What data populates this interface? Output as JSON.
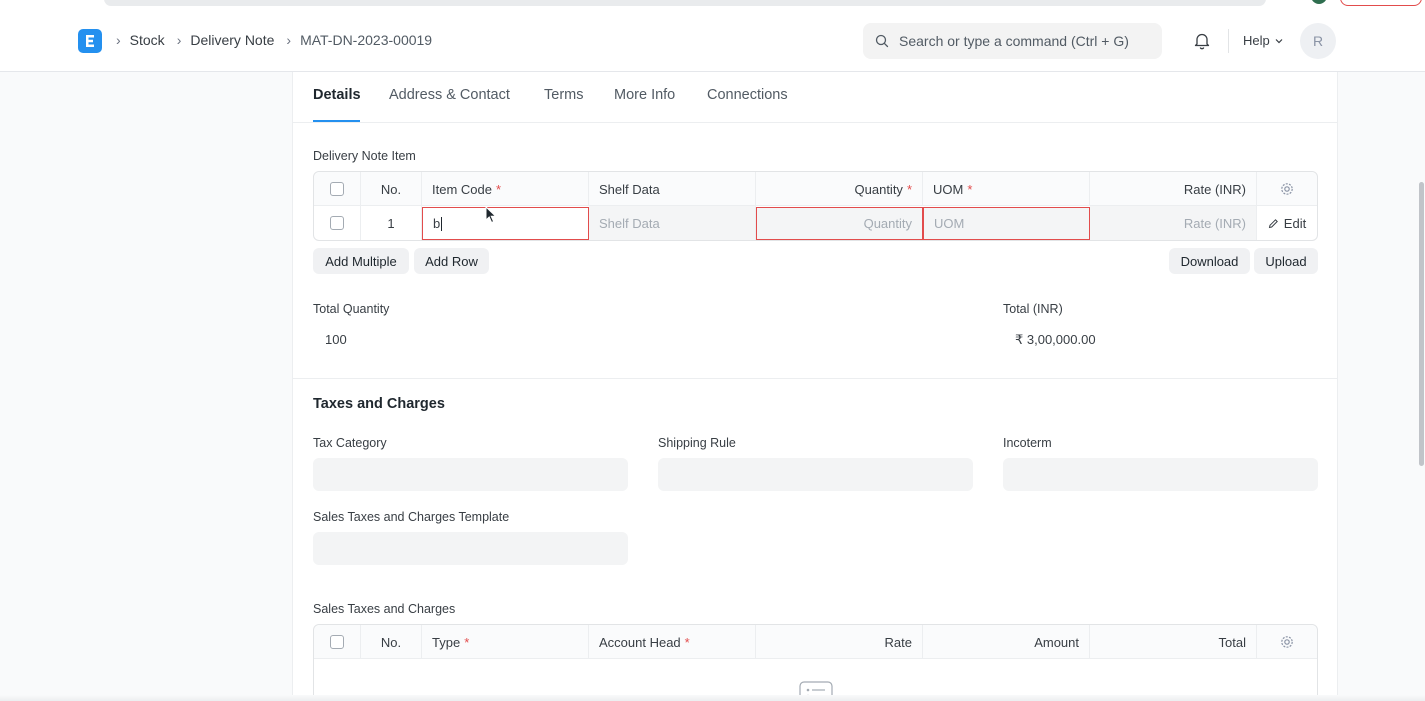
{
  "navbar": {
    "breadcrumbs": [
      "Stock",
      "Delivery Note",
      "MAT-DN-2023-00019"
    ],
    "search_placeholder": "Search or type a command (Ctrl + G)",
    "help_label": "Help",
    "avatar_initial": "R",
    "logo_letter": "E"
  },
  "tabs": [
    "Details",
    "Address & Contact",
    "Terms",
    "More Info",
    "Connections"
  ],
  "active_tab": "Details",
  "items_table": {
    "label": "Delivery Note Item",
    "columns": {
      "no": "No.",
      "item_code": "Item Code",
      "shelf_data": "Shelf Data",
      "quantity": "Quantity",
      "uom": "UOM",
      "rate": "Rate (INR)"
    },
    "row": {
      "no": "1",
      "item_code_value": "b",
      "shelf_placeholder": "Shelf Data",
      "quantity_placeholder": "Quantity",
      "uom_placeholder": "UOM",
      "rate_placeholder": "Rate (INR)",
      "edit_label": "Edit"
    },
    "buttons": {
      "add_multiple": "Add Multiple",
      "add_row": "Add Row",
      "download": "Download",
      "upload": "Upload"
    }
  },
  "totals": {
    "total_quantity_label": "Total Quantity",
    "total_quantity_value": "100",
    "total_label": "Total (INR)",
    "total_value": "₹ 3,00,000.00"
  },
  "taxes": {
    "section_title": "Taxes and Charges",
    "tax_category_label": "Tax Category",
    "shipping_rule_label": "Shipping Rule",
    "incoterm_label": "Incoterm",
    "template_label": "Sales Taxes and Charges Template",
    "table_label": "Sales Taxes and Charges",
    "columns": {
      "no": "No.",
      "type": "Type",
      "account_head": "Account Head",
      "rate": "Rate",
      "amount": "Amount",
      "total": "Total"
    }
  },
  "colors": {
    "accent": "#2490ef",
    "error": "#e24c4c",
    "text": "#1f272e"
  }
}
